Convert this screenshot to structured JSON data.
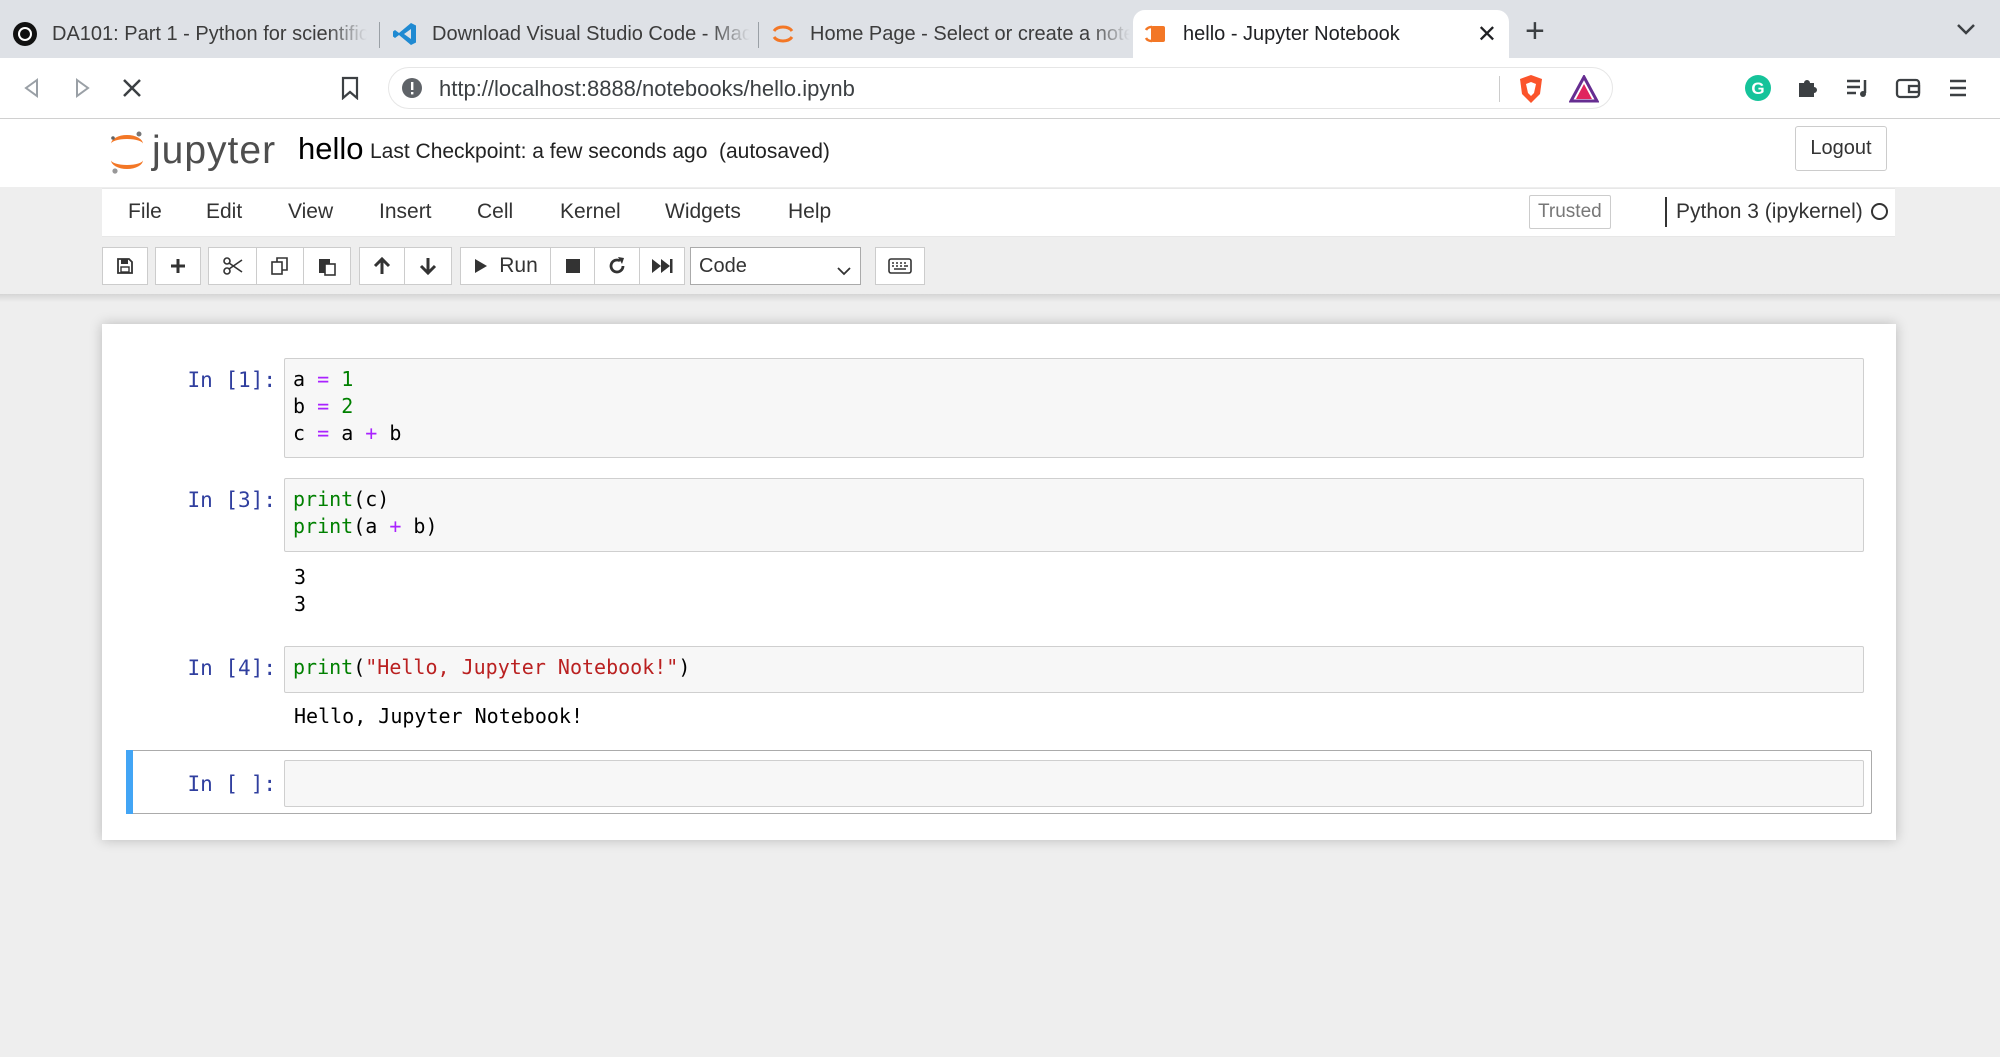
{
  "browser": {
    "tabs": [
      {
        "title": "DA101: Part 1 - Python for scientific",
        "icon": "github-icon"
      },
      {
        "title": "Download Visual Studio Code - Mac",
        "icon": "vscode-icon"
      },
      {
        "title": "Home Page - Select or create a note",
        "icon": "jupyter-icon"
      },
      {
        "title": "hello - Jupyter Notebook",
        "icon": "jupyter-notebook-icon",
        "active": true
      }
    ],
    "url": "http://localhost:8888/notebooks/hello.ipynb"
  },
  "header": {
    "logo_text": "jupyter",
    "notebook_name": "hello",
    "checkpoint": "Last Checkpoint: a few seconds ago",
    "autosave": "(autosaved)",
    "logout_label": "Logout"
  },
  "menubar": {
    "items": [
      "File",
      "Edit",
      "View",
      "Insert",
      "Cell",
      "Kernel",
      "Widgets",
      "Help"
    ],
    "trusted_label": "Trusted",
    "kernel_name": "Python 3 (ipykernel)"
  },
  "toolbar": {
    "run_label": "Run",
    "cell_type": "Code"
  },
  "cells": [
    {
      "prompt": "In [1]:",
      "lines": [
        [
          [
            "a",
            ""
          ],
          [
            " ",
            ""
          ],
          [
            "=",
            "op"
          ],
          [
            " ",
            ""
          ],
          [
            "1",
            "num"
          ]
        ],
        [
          [
            "b",
            ""
          ],
          [
            " ",
            ""
          ],
          [
            "=",
            "op"
          ],
          [
            " ",
            ""
          ],
          [
            "2",
            "num"
          ]
        ],
        [
          [
            "c",
            ""
          ],
          [
            " ",
            ""
          ],
          [
            "=",
            "op"
          ],
          [
            " ",
            ""
          ],
          [
            "a",
            ""
          ],
          [
            " ",
            ""
          ],
          [
            "+",
            "op"
          ],
          [
            " ",
            ""
          ],
          [
            "b",
            ""
          ]
        ]
      ],
      "output": []
    },
    {
      "prompt": "In [3]:",
      "lines": [
        [
          [
            "print",
            "kw"
          ],
          [
            "(c)",
            ""
          ]
        ],
        [
          [
            "print",
            "kw"
          ],
          [
            "(a ",
            ""
          ],
          [
            "+",
            "op"
          ],
          [
            " b)",
            ""
          ]
        ]
      ],
      "output": [
        "3",
        "3"
      ]
    },
    {
      "prompt": "In [4]:",
      "lines": [
        [
          [
            "print",
            "kw"
          ],
          [
            "(",
            ""
          ],
          [
            "\"Hello, Jupyter Notebook!\"",
            "str"
          ],
          [
            ")",
            ""
          ]
        ]
      ],
      "output": [
        "Hello, Jupyter Notebook!"
      ]
    },
    {
      "prompt": "In [ ]:",
      "lines": [],
      "output": []
    }
  ],
  "colors": {
    "prompt": "#303f9f",
    "selected_bar": "#42a5f5",
    "keyword": "#008000",
    "operator": "#aa22ff",
    "string": "#ba2121"
  }
}
